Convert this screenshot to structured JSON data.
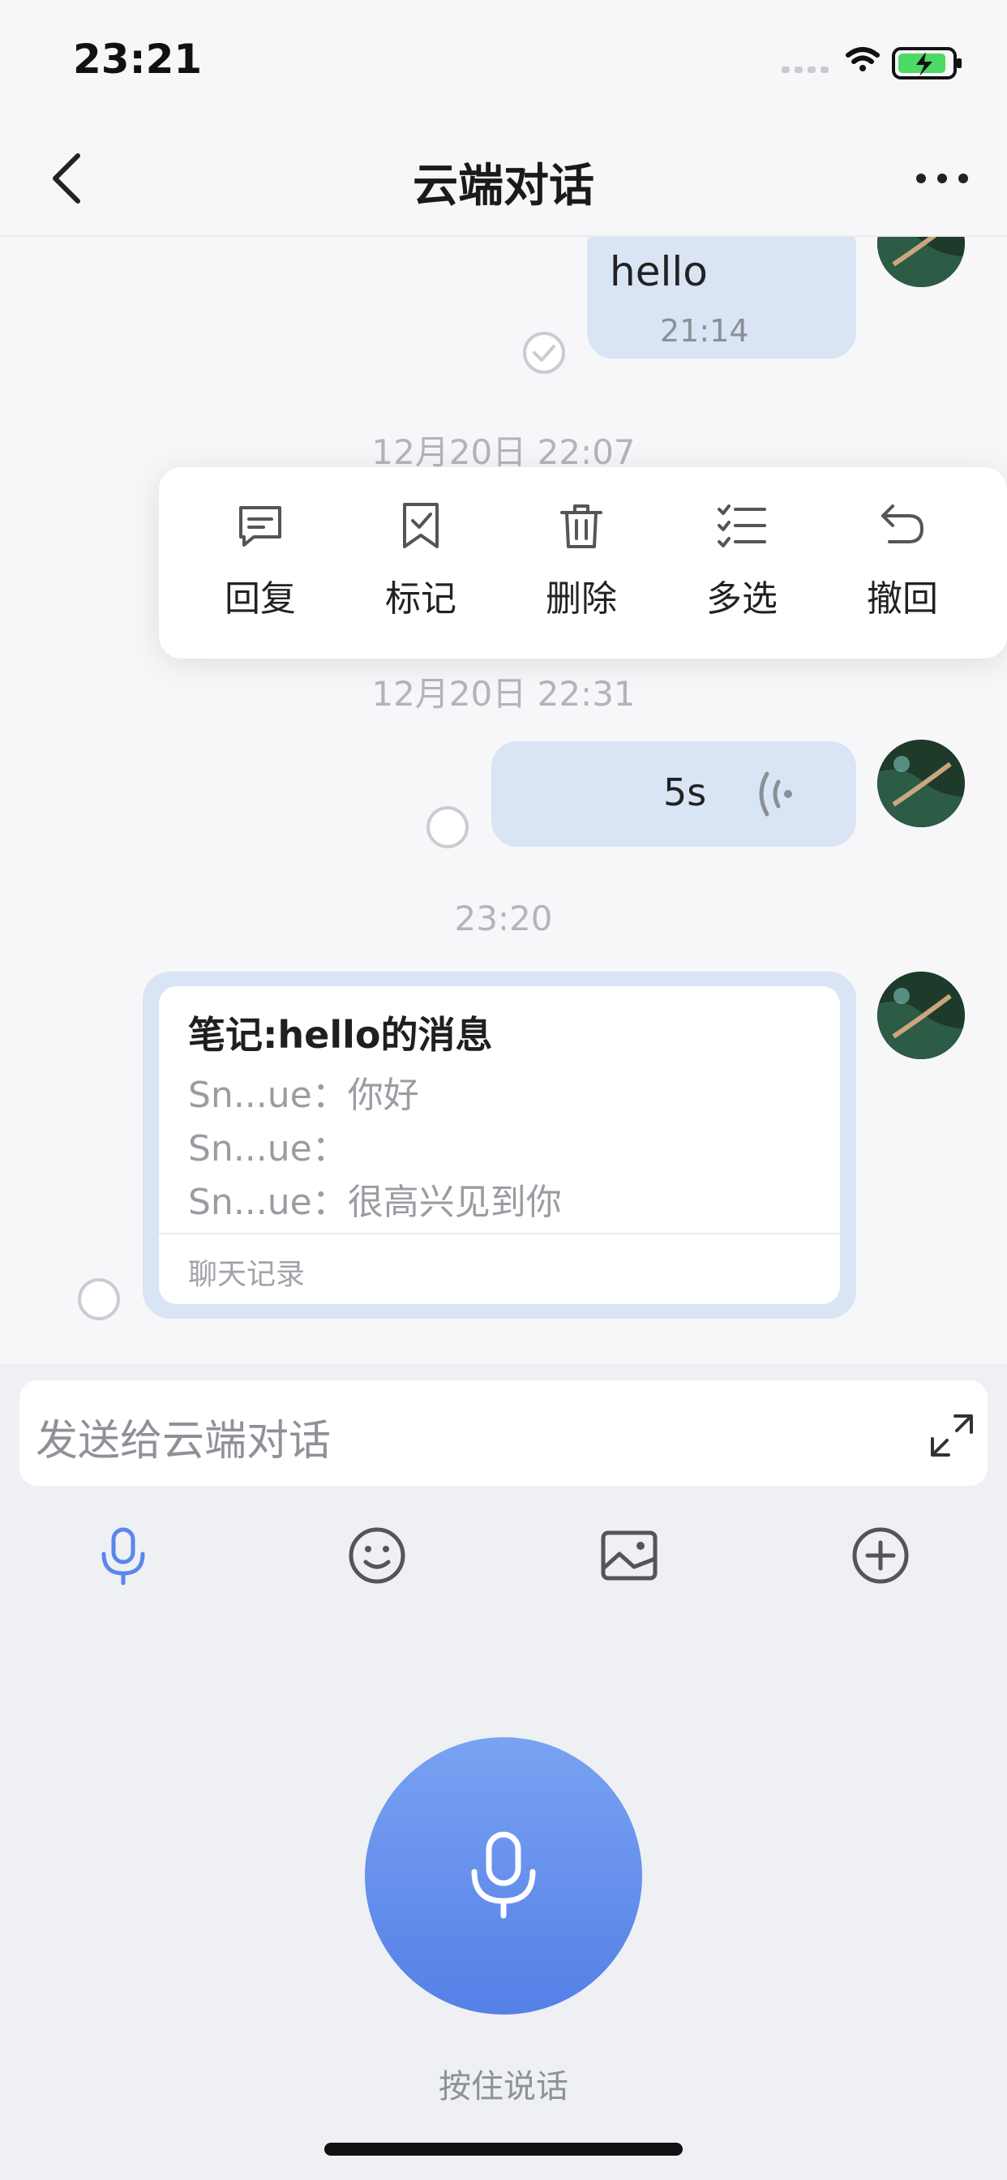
{
  "status_bar": {
    "time": "23:21"
  },
  "nav": {
    "title": "云端对话"
  },
  "messages": {
    "hello": {
      "text": "hello",
      "time": "21:14"
    },
    "divider_1": "12月20日 22:07",
    "divider_2": "12月20日 22:31",
    "voice": {
      "duration": "5s"
    },
    "divider_3": "23:20",
    "note": {
      "title": "笔记:hello的消息",
      "lines": [
        "Sn...ue：你好",
        "Sn...ue：",
        "Sn...ue：很高兴见到你"
      ],
      "footer": "聊天记录"
    }
  },
  "context_menu": {
    "items": [
      {
        "label": "回复",
        "icon": "reply-icon"
      },
      {
        "label": "标记",
        "icon": "bookmark-icon"
      },
      {
        "label": "删除",
        "icon": "trash-icon"
      },
      {
        "label": "多选",
        "icon": "multi-select-icon"
      },
      {
        "label": "撤回",
        "icon": "undo-icon"
      }
    ]
  },
  "composer": {
    "placeholder": "发送给云端对话",
    "voice_hint": "按住说话",
    "tools": [
      "microphone-icon",
      "emoji-icon",
      "image-icon",
      "plus-circle-icon"
    ]
  },
  "colors": {
    "bubble": "#d9e4f5",
    "accent": "#5b86ea",
    "background": "#f7f7f9"
  }
}
